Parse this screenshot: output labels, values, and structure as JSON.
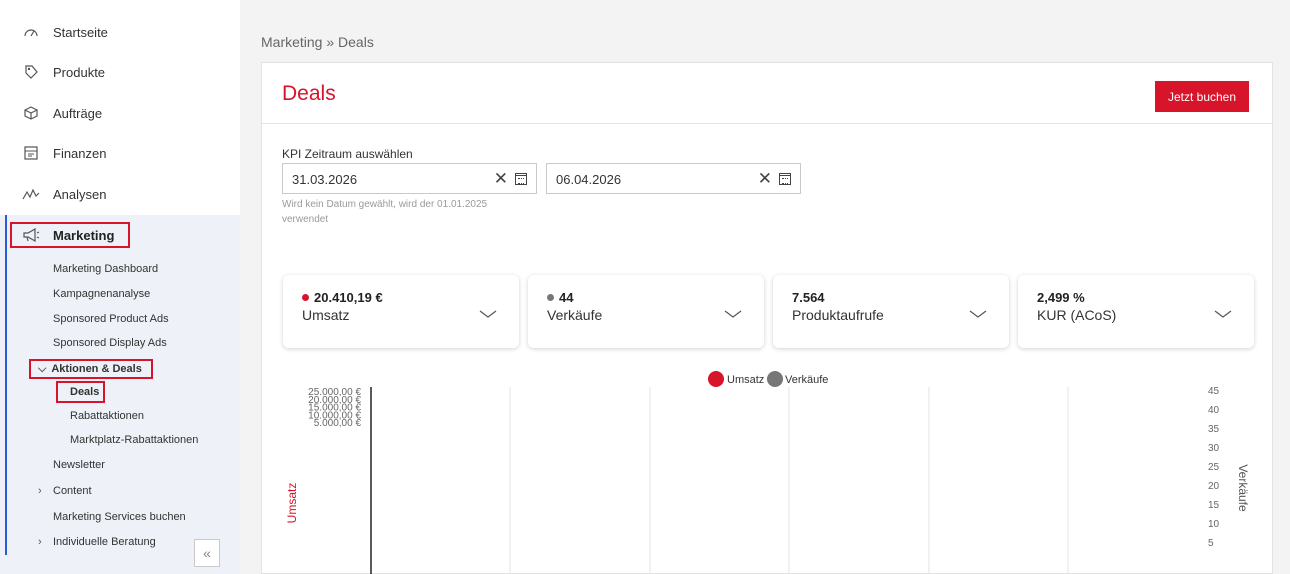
{
  "sidebar": {
    "items": [
      {
        "label": "Startseite",
        "icon": "speedometer-icon"
      },
      {
        "label": "Produkte",
        "icon": "price-tag-icon"
      },
      {
        "label": "Aufträge",
        "icon": "package-icon"
      },
      {
        "label": "Finanzen",
        "icon": "finance-icon"
      },
      {
        "label": "Analysen",
        "icon": "analytics-icon"
      }
    ],
    "marketing": {
      "label": "Marketing",
      "icon": "megaphone-icon",
      "subitems": [
        "Marketing Dashboard",
        "Kampagnenanalyse",
        "Sponsored Product Ads",
        "Sponsored Display Ads"
      ],
      "aktionen": {
        "label": "Aktionen & Deals",
        "children": [
          "Deals",
          "Rabattaktionen",
          "Marktplatz-Rabattaktionen"
        ]
      },
      "more": [
        "Newsletter",
        "Content",
        "Marketing Services buchen",
        "Individuelle Beratung"
      ]
    },
    "collapse_glyph": "«"
  },
  "breadcrumb": "Marketing » Deals",
  "page": {
    "title": "Deals",
    "book_button": "Jetzt buchen"
  },
  "kpi_period": {
    "label": "KPI Zeitraum auswählen",
    "start": "31.03.2026",
    "end": "06.04.2026",
    "clear_glyph": "✕",
    "hint": "Wird kein Datum gewählt, wird der 01.01.2025 verwendet"
  },
  "kpis": [
    {
      "value": "20.410,19 €",
      "name": "Umsatz",
      "dot": "#d8142a"
    },
    {
      "value": "44",
      "name": "Verkäufe",
      "dot": "#777777"
    },
    {
      "value": "7.564",
      "name": "Produktaufrufe",
      "dot": null
    },
    {
      "value": "2,499 %",
      "name": "KUR (ACoS)",
      "dot": null
    }
  ],
  "colors": {
    "accent": "#d8142a",
    "secondary": "#777777",
    "nav_highlight": "#2a5bd7"
  },
  "chart_data": {
    "type": "line",
    "legend": [
      "Umsatz",
      "Verkäufe"
    ],
    "legend_position": "top-center",
    "ylabel": "Umsatz",
    "y2label": "Verkäufe",
    "y_ticks": [
      "25.000,00 €",
      "20.000,00 €",
      "15.000,00 €",
      "10.000,00 €",
      "5.000,00 €"
    ],
    "y_range": [
      0,
      25000
    ],
    "y2_ticks": [
      "45",
      "40",
      "35",
      "30",
      "25",
      "20",
      "15",
      "10",
      "5"
    ],
    "y2_range": [
      0,
      45
    ],
    "grid": "vertical"
  }
}
